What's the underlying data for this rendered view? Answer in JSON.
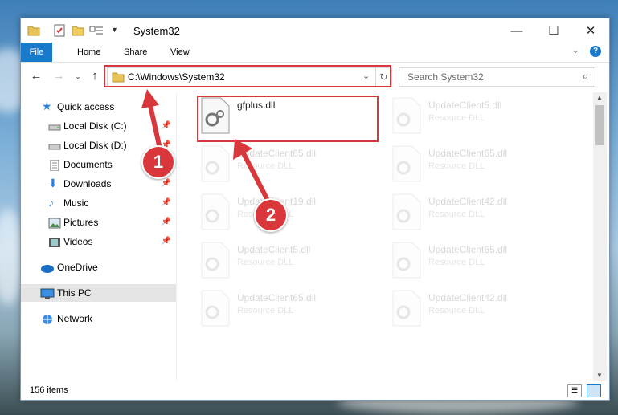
{
  "window": {
    "title": "System32",
    "controls": {
      "minimize": "—",
      "maximize": "☐",
      "close": "✕"
    }
  },
  "ribbon": {
    "tabs": [
      "File",
      "Home",
      "Share",
      "View"
    ],
    "collapse_icon": "chevron-down",
    "help_icon": "?"
  },
  "navigation": {
    "address": "C:\\Windows\\System32",
    "search_placeholder": "Search System32"
  },
  "sidebar": {
    "items": [
      {
        "label": "Quick access",
        "icon": "star-icon",
        "pinned": false
      },
      {
        "label": "Local Disk (C:)",
        "icon": "drive-icon",
        "pinned": true
      },
      {
        "label": "Local Disk (D:)",
        "icon": "drive-icon",
        "pinned": true
      },
      {
        "label": "Documents",
        "icon": "documents-icon",
        "pinned": true
      },
      {
        "label": "Downloads",
        "icon": "download-icon",
        "pinned": true
      },
      {
        "label": "Music",
        "icon": "music-icon",
        "pinned": true
      },
      {
        "label": "Pictures",
        "icon": "pictures-icon",
        "pinned": true
      },
      {
        "label": "Videos",
        "icon": "videos-icon",
        "pinned": true
      },
      {
        "label": "OneDrive",
        "icon": "cloud-icon",
        "pinned": false
      },
      {
        "label": "This PC",
        "icon": "pc-icon",
        "pinned": false,
        "selected": true
      },
      {
        "label": "Network",
        "icon": "network-icon",
        "pinned": false
      }
    ]
  },
  "files": [
    {
      "name": "gfplus.dll",
      "type": "",
      "highlighted": true
    },
    {
      "name": "UpdateClient5.dll",
      "type": "Resource DLL"
    },
    {
      "name": "UpdateClient65.dll",
      "type": "Resource DLL"
    },
    {
      "name": "UpdateClient65.dll",
      "type": "Resource DLL"
    },
    {
      "name": "UpdateClient19.dll",
      "type": "Resource DLL"
    },
    {
      "name": "UpdateClient42.dll",
      "type": "Resource DLL"
    },
    {
      "name": "UpdateClient5.dll",
      "type": "Resource DLL"
    },
    {
      "name": "UpdateClient65.dll",
      "type": "Resource DLL"
    },
    {
      "name": "UpdateClient65.dll",
      "type": "Resource DLL"
    },
    {
      "name": "UpdateClient42.dll",
      "type": "Resource DLL"
    }
  ],
  "status": {
    "item_count": "156 items"
  },
  "annotations": {
    "step1": "1",
    "step2": "2",
    "color": "#d9373b"
  }
}
